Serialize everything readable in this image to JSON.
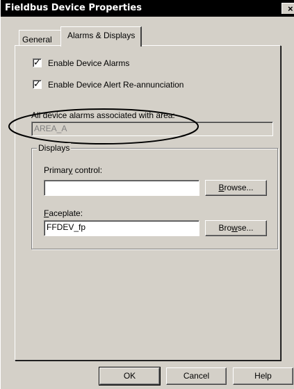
{
  "window": {
    "title": "Fieldbus Device Properties",
    "close_label": "×"
  },
  "tabs": [
    {
      "label": "General"
    },
    {
      "label": "Alarms & Displays"
    }
  ],
  "alarms": {
    "enable_device_alarms": {
      "label": "Enable Device Alarms",
      "checked": true
    },
    "enable_reannunciation": {
      "label": "Enable Device Alert Re-annunciation",
      "checked": true
    },
    "area_label": "All device alarms associated with area:",
    "area_value": "AREA_A"
  },
  "displays": {
    "group_title": "Displays",
    "primary_label_pre": "Primar",
    "primary_label_u": "y",
    "primary_label_post": " control:",
    "primary_value": "",
    "primary_browse_u": "B",
    "primary_browse_rest": "rowse...",
    "faceplate_label_u": "F",
    "faceplate_label_rest": "aceplate:",
    "faceplate_value": "FFDEV_fp",
    "faceplate_browse_pre": "Bro",
    "faceplate_browse_u": "w",
    "faceplate_browse_post": "se..."
  },
  "buttons": {
    "ok": "OK",
    "cancel": "Cancel",
    "help": "Help"
  }
}
